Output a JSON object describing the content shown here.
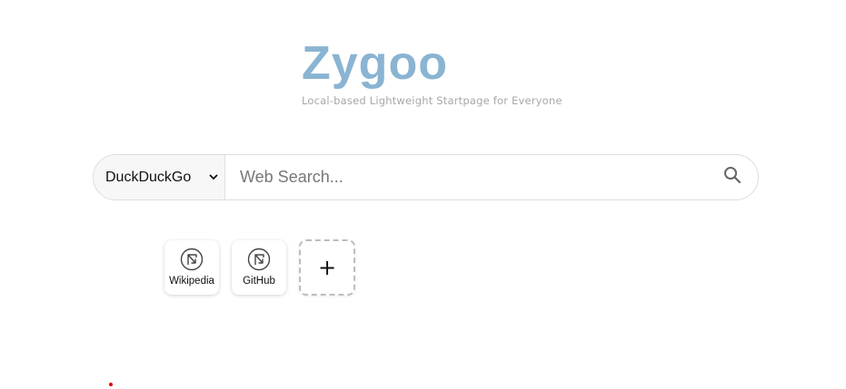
{
  "header": {
    "title": "Zygoo",
    "subtitle": "Local-based Lightweight Startpage for Everyone"
  },
  "search": {
    "engine": "DuckDuckGo",
    "placeholder": "Web Search..."
  },
  "shortcuts": [
    {
      "label": "Wikipedia",
      "icon": "link-icon"
    },
    {
      "label": "GitHub",
      "icon": "link-icon"
    }
  ],
  "add_shortcut": {
    "label": "+"
  },
  "colors": {
    "logo": "#8ab4d2",
    "subtitle": "#a8a8a8",
    "marker": "#e00000"
  }
}
